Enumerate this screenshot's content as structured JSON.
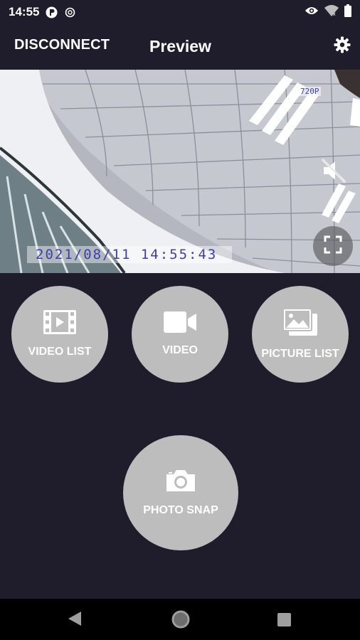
{
  "status_bar": {
    "time": "14:55",
    "icons": [
      "app-notification-icon",
      "sync-icon",
      "eye-icon",
      "wifi-icon",
      "battery-icon"
    ]
  },
  "app_bar": {
    "disconnect_label": "DISCONNECT",
    "title": "Preview",
    "settings_icon": "gear-icon"
  },
  "preview": {
    "resolution": "720P",
    "timestamp": "2021/08/11 14:55:43",
    "mute_icon": "speaker-muted-icon",
    "fullscreen_icon": "fullscreen-icon"
  },
  "actions": {
    "video_list": {
      "label": "VIDEO LIST",
      "icon": "film-strip-icon"
    },
    "video": {
      "label": "VIDEO",
      "icon": "video-camera-icon"
    },
    "picture_list": {
      "label": "PICTURE LIST",
      "icon": "image-stack-icon"
    },
    "photo_snap": {
      "label": "PHOTO SNAP",
      "icon": "camera-icon"
    }
  },
  "nav_bar": {
    "back_icon": "back-triangle-icon",
    "home_icon": "home-circle-icon",
    "recents_icon": "recents-square-icon"
  },
  "colors": {
    "background": "#1f1d2b",
    "button": "#bdbdbd",
    "overlay_text": "#3d3fae"
  }
}
